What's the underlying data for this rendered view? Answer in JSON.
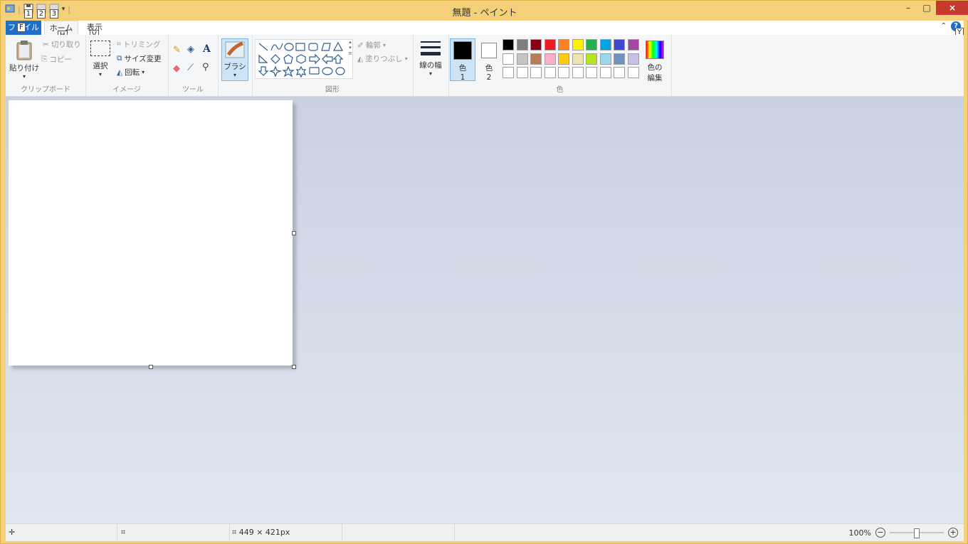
{
  "window": {
    "title": "無題 - ペイント",
    "minimize": "–",
    "maximize": "□",
    "close": "×"
  },
  "qat_keytips": [
    "1",
    "2",
    "3"
  ],
  "tabs": {
    "file": "ファイル",
    "file_keytip": "F",
    "home": "ホーム",
    "home_keytip": "H",
    "view": "表示",
    "view_keytip": "V",
    "help_keytip": "Y"
  },
  "clipboard": {
    "paste": "貼り付け",
    "cut": "切り取り",
    "copy": "コピー",
    "label": "クリップボード"
  },
  "image": {
    "select": "選択",
    "crop": "トリミング",
    "resize": "サイズ変更",
    "rotate": "回転",
    "label": "イメージ"
  },
  "tools": {
    "label": "ツール"
  },
  "brush": {
    "label": "ブラシ"
  },
  "shapes": {
    "outline": "輪郭",
    "fill": "塗りつぶし",
    "label": "図形"
  },
  "size": {
    "label": "線の幅"
  },
  "colors": {
    "color1": "色\n1",
    "color1_a": "色",
    "color1_b": "1",
    "color2_a": "色",
    "color2_b": "2",
    "edit_a": "色の",
    "edit_b": "編集",
    "label": "色",
    "palette_row1": [
      "#000000",
      "#7f7f7f",
      "#880015",
      "#ed1c24",
      "#ff7f27",
      "#fff200",
      "#22b14c",
      "#00a2e8",
      "#3f48cc",
      "#a349a4"
    ],
    "palette_row2": [
      "#ffffff",
      "#c3c3c3",
      "#b97a57",
      "#ffaec9",
      "#ffc90e",
      "#efe4b0",
      "#b5e61d",
      "#99d9ea",
      "#7092be",
      "#c8bfe7"
    ],
    "active_color1": "#000000",
    "active_color2": "#ffffff"
  },
  "status": {
    "dimensions": "449 × 421px",
    "zoom": "100%"
  }
}
